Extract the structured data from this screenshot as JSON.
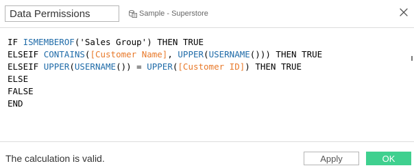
{
  "dialog": {
    "title_value": "Data Permissions",
    "datasource_label": "Sample - Superstore",
    "close_icon": "close-icon",
    "datasource_icon": "datasource-icon"
  },
  "editor": {
    "lines": [
      [
        {
          "type": "kw",
          "text": "IF "
        },
        {
          "type": "fn",
          "text": "ISMEMBEROF"
        },
        {
          "type": "op",
          "text": "("
        },
        {
          "type": "str",
          "text": "'Sales Group'"
        },
        {
          "type": "op",
          "text": ") "
        },
        {
          "type": "kw",
          "text": "THEN TRUE"
        }
      ],
      [
        {
          "type": "kw",
          "text": "ELSEIF "
        },
        {
          "type": "fn",
          "text": "CONTAINS"
        },
        {
          "type": "op",
          "text": "("
        },
        {
          "type": "field",
          "text": "[Customer Name]"
        },
        {
          "type": "op",
          "text": ", "
        },
        {
          "type": "fn",
          "text": "UPPER"
        },
        {
          "type": "op",
          "text": "("
        },
        {
          "type": "fn",
          "text": "USERNAME"
        },
        {
          "type": "op",
          "text": "())) "
        },
        {
          "type": "kw",
          "text": "THEN TRUE"
        }
      ],
      [
        {
          "type": "kw",
          "text": "ELSEIF "
        },
        {
          "type": "fn",
          "text": "UPPER"
        },
        {
          "type": "op",
          "text": "("
        },
        {
          "type": "fn",
          "text": "USERNAME"
        },
        {
          "type": "op",
          "text": "()) = "
        },
        {
          "type": "fn",
          "text": "UPPER"
        },
        {
          "type": "op",
          "text": "("
        },
        {
          "type": "field",
          "text": "[Customer ID]"
        },
        {
          "type": "op",
          "text": ") "
        },
        {
          "type": "kw",
          "text": "THEN TRUE"
        }
      ],
      [
        {
          "type": "kw",
          "text": "ELSE"
        }
      ],
      [
        {
          "type": "kw",
          "text": "FALSE"
        }
      ],
      [
        {
          "type": "kw",
          "text": "END"
        }
      ]
    ]
  },
  "footer": {
    "status_text": "The calculation is valid.",
    "apply_label": "Apply",
    "ok_label": "OK"
  },
  "colors": {
    "function": "#1f6ba8",
    "field": "#e8792a",
    "ok_button": "#3fd08f"
  }
}
